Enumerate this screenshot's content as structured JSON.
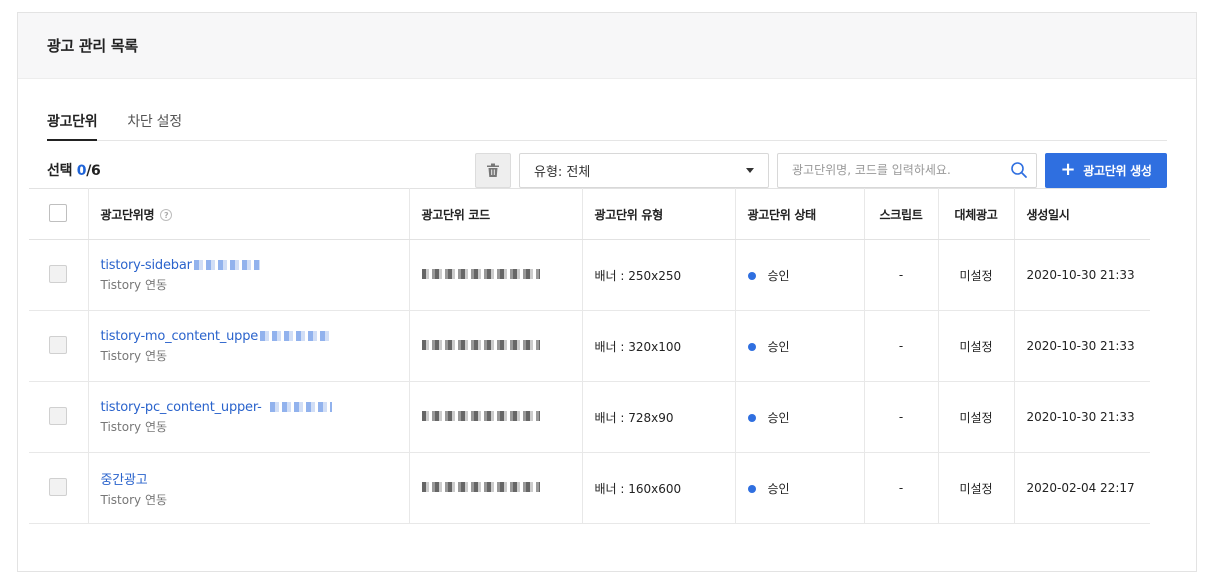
{
  "panel": {
    "title": "광고 관리 목록"
  },
  "tabs": [
    {
      "label": "광고단위",
      "active": true
    },
    {
      "label": "차단 설정",
      "active": false
    }
  ],
  "toolbar": {
    "selection_prefix": "선택 ",
    "selected_count": "0",
    "total_count": "/6",
    "filter_value": "유형: 전체",
    "search_placeholder": "광고단위명, 코드를 입력하세요.",
    "create_label": "광고단위 생성"
  },
  "table": {
    "headers": [
      "광고단위명",
      "광고단위 코드",
      "광고단위 유형",
      "광고단위 상태",
      "스크립트",
      "대체광고",
      "생성일시"
    ],
    "rows": [
      {
        "name": "tistory-sidebar",
        "sub": "Tistory 연동",
        "type": "배너 : 250x250",
        "status": "승인",
        "script": "-",
        "fallback": "미설정",
        "created": "2020-10-30 21:33"
      },
      {
        "name": "tistory-mo_content_uppe",
        "sub": "Tistory 연동",
        "type": "배너 : 320x100",
        "status": "승인",
        "script": "-",
        "fallback": "미설정",
        "created": "2020-10-30 21:33"
      },
      {
        "name": "tistory-pc_content_upper-",
        "sub": "Tistory 연동",
        "type": "배너 : 728x90",
        "status": "승인",
        "script": "-",
        "fallback": "미설정",
        "created": "2020-10-30 21:33"
      },
      {
        "name": "중간광고",
        "sub": "Tistory 연동",
        "type": "배너 : 160x600",
        "status": "승인",
        "script": "-",
        "fallback": "미설정",
        "created": "2020-02-04 22:17"
      }
    ]
  },
  "colors": {
    "accent": "#2f6fe0",
    "link": "#2a63cc",
    "status_approved": "#2f6fe0"
  },
  "icons": {
    "trash": "trash-icon",
    "search": "search-icon",
    "help": "help-icon",
    "plus": "plus-icon",
    "caret": "chevron-down-icon"
  }
}
